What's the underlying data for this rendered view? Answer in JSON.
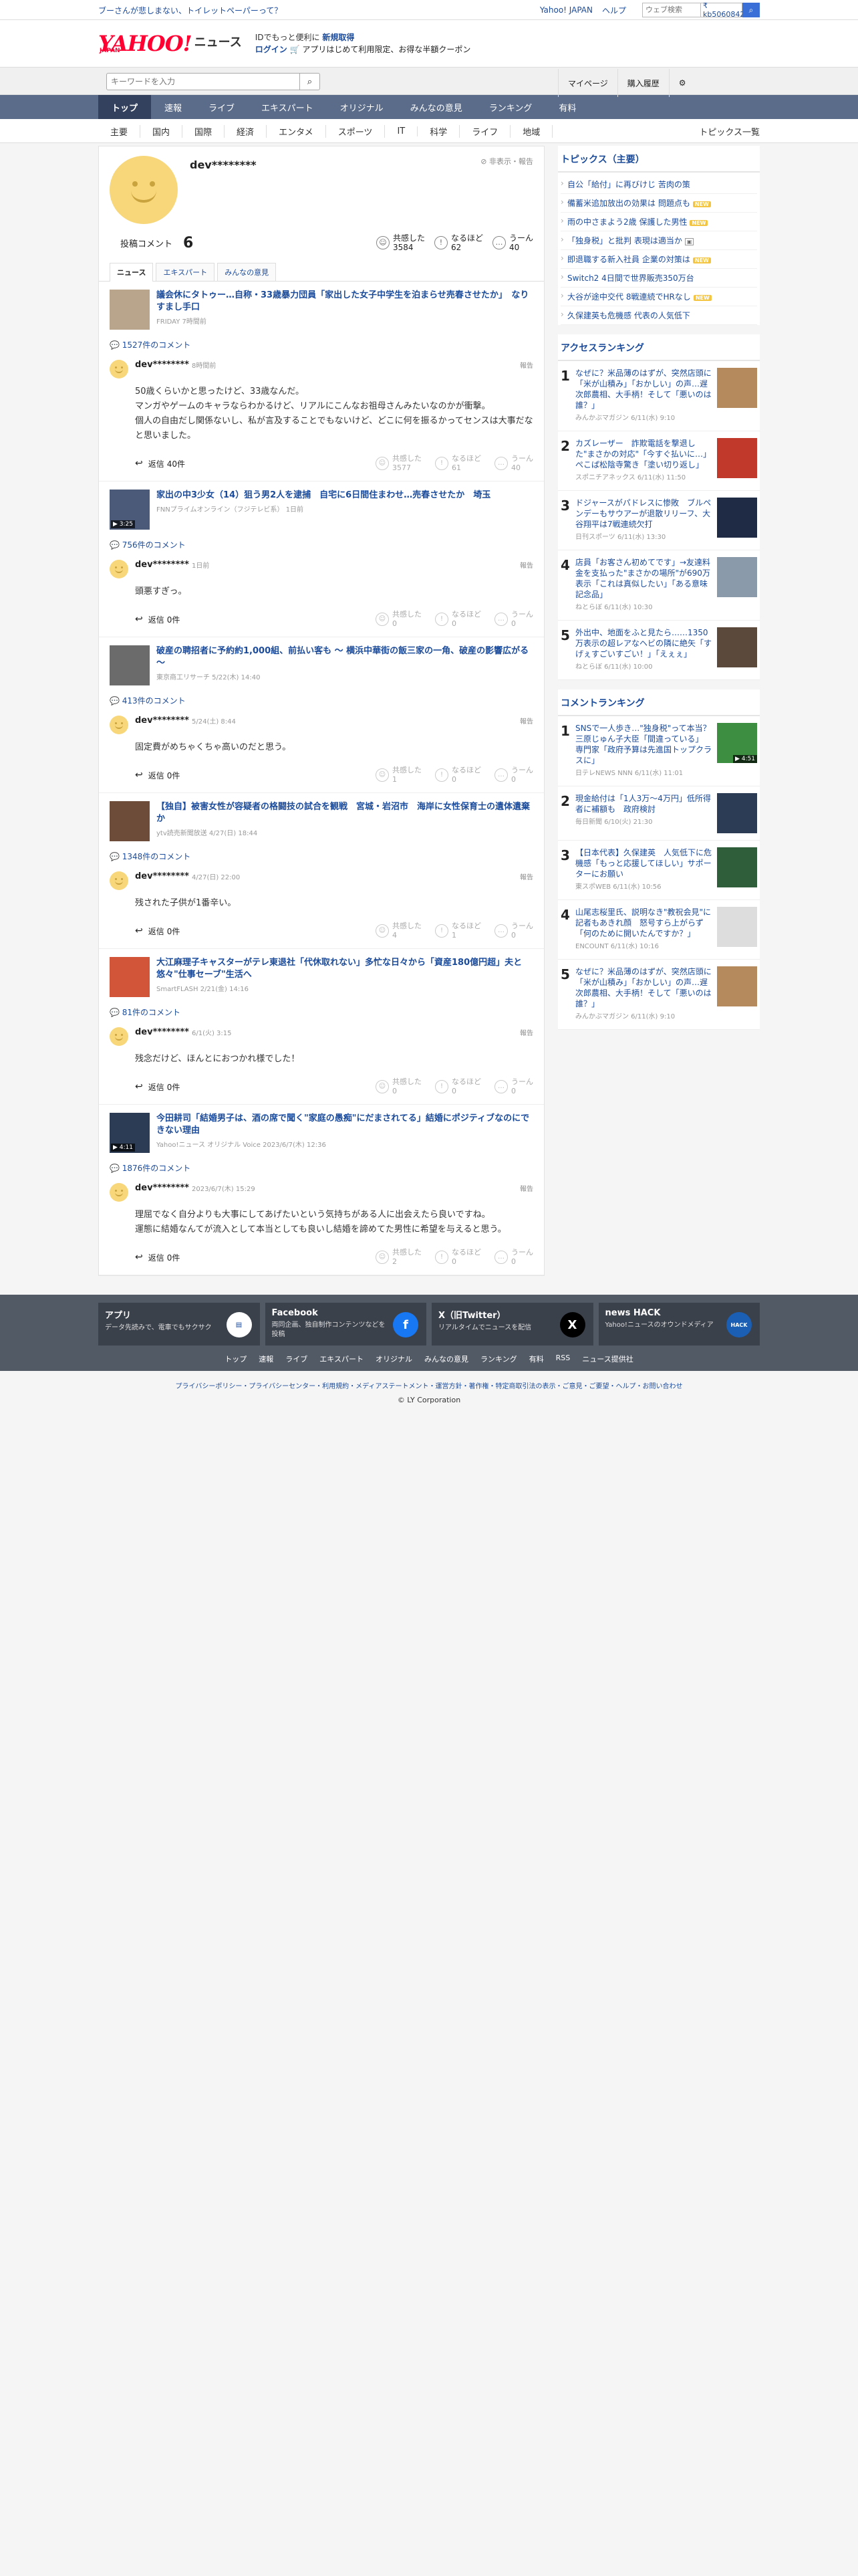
{
  "topbar": {
    "promo": "ブーさんが悲しまない、トイレットペーパーって？",
    "links": [
      "Yahoo! JAPAN",
      "ヘルプ"
    ],
    "search_placeholder": "ウェブ検索",
    "balance": "₹ kb5060842"
  },
  "header": {
    "logo_y": "YAHOO!",
    "logo_japan": "JAPAN",
    "logo_news": "ニュース",
    "line1": "IDでもっと便利に",
    "line1_bold": "新規取得",
    "login": "ログイン",
    "line2": "🛒 アプリはじめて利用限定、お得な半額クーポン"
  },
  "search": {
    "placeholder": "キーワードを入力",
    "right": [
      "マイページ",
      "購入履歴"
    ]
  },
  "nav": [
    "トップ",
    "速報",
    "ライブ",
    "エキスパート",
    "オリジナル",
    "みんなの意見",
    "ランキング",
    "有料"
  ],
  "subnav": [
    "主要",
    "国内",
    "国際",
    "経済",
    "エンタメ",
    "スポーツ",
    "IT",
    "科学",
    "ライフ",
    "地域"
  ],
  "subnav_more": "トピックス一覧",
  "profile": {
    "name": "dev********",
    "hide": "非表示・報告",
    "count_label": "投稿コメント",
    "count": "6",
    "reactions": [
      {
        "label": "共感した",
        "value": "3584",
        "icon": "thumb"
      },
      {
        "label": "なるほど",
        "value": "62",
        "icon": "lightbulb"
      },
      {
        "label": "うーん",
        "value": "40",
        "icon": "hmm"
      }
    ],
    "tabs": [
      "ニュース",
      "エキスパート",
      "みんなの意見"
    ]
  },
  "posts": [
    {
      "title": "議会休にタトゥー…自称・33歳暴力団員「家出した女子中学生を泊まらせ売春させたか」　なりすまし手口",
      "meta": "FRIDAY 7時間前",
      "comment_count": "1527件のコメント",
      "user": "dev********",
      "time": "8時間前",
      "report": "報告",
      "text": "50歳くらいかと思ったけど、33歳なんだ。\nマンガやゲームのキャラならわかるけど、リアルにこんなお祖母さんみたいなのかが衝撃。\n個人の自由だし関係ないし、私が言及することでもないけど、どこに何を振るかってセンスは大事だなと思いました。",
      "reply": "返信",
      "reply_count": "40件",
      "reactions": [
        {
          "label": "共感した",
          "value": "3577"
        },
        {
          "label": "なるほど",
          "value": "61"
        },
        {
          "label": "うーん",
          "value": "40"
        }
      ],
      "thumb_color": "#b9a48c",
      "video": ""
    },
    {
      "title": "家出の中3少女（14）狙う男2人を逮捕　自宅に6日間住まわせ…売春させたか　埼玉",
      "meta": "FNNプライムオンライン（フジテレビ系） 1日前",
      "comment_count": "756件のコメント",
      "user": "dev********",
      "time": "1日前",
      "report": "報告",
      "text": "頭悪すぎっ。",
      "reply": "返信",
      "reply_count": "0件",
      "reactions": [
        {
          "label": "共感した",
          "value": "0"
        },
        {
          "label": "なるほど",
          "value": "0"
        },
        {
          "label": "うーん",
          "value": "0"
        }
      ],
      "thumb_color": "#4a5a78",
      "video": "▶ 3:25"
    },
    {
      "title": "破産の聘招者に予約約1,000組、前払い客も ～ 横浜中華街の飯三家の一角、破産の影響広がる ～",
      "meta": "東京商工リサーチ 5/22(木) 14:40",
      "comment_count": "413件のコメント",
      "user": "dev********",
      "time": "5/24(土) 8:44",
      "report": "報告",
      "text": "固定費がめちゃくちゃ高いのだと思う。",
      "reply": "返信",
      "reply_count": "0件",
      "reactions": [
        {
          "label": "共感した",
          "value": "1"
        },
        {
          "label": "なるほど",
          "value": "0"
        },
        {
          "label": "うーん",
          "value": "0"
        }
      ],
      "thumb_color": "#6b6b6b",
      "video": ""
    },
    {
      "title": "【独自】被害女性が容疑者の格闘技の試合を観戦　宮城・岩沼市　海岸に女性保育士の遺体遺棄か",
      "meta": "ytv読売新聞放送 4/27(日) 18:44",
      "comment_count": "1348件のコメント",
      "user": "dev********",
      "time": "4/27(日) 22:00",
      "report": "報告",
      "text": "残された子供が1番辛い。",
      "reply": "返信",
      "reply_count": "0件",
      "reactions": [
        {
          "label": "共感した",
          "value": "4"
        },
        {
          "label": "なるほど",
          "value": "1"
        },
        {
          "label": "うーん",
          "value": "0"
        }
      ],
      "thumb_color": "#6e4c3a",
      "video": ""
    },
    {
      "title": "大江麻理子キャスターがテレ東退社「代休取れない」多忙な日々から「資産180億円超」夫と悠々\"仕事セーブ\"生活へ",
      "meta": "SmartFLASH 2/21(金) 14:16",
      "comment_count": "81件のコメント",
      "user": "dev********",
      "time": "6/1(火) 3:15",
      "report": "報告",
      "text": "残念だけど、ほんとにおつかれ様でした！",
      "reply": "返信",
      "reply_count": "0件",
      "reactions": [
        {
          "label": "共感した",
          "value": "0"
        },
        {
          "label": "なるほど",
          "value": "0"
        },
        {
          "label": "うーん",
          "value": "0"
        }
      ],
      "thumb_color": "#d2553a",
      "video": ""
    },
    {
      "title": "今田耕司「結婚男子は、酒の席で聞く\"家庭の愚痴\"にだまされてる」結婚にポジティブなのにできない理由",
      "meta": "Yahoo!ニュース オリジナル Voice 2023/6/7(木) 12:36",
      "comment_count": "1876件のコメント",
      "user": "dev********",
      "time": "2023/6/7(木) 15:29",
      "report": "報告",
      "text": "理屈でなく自分よりも大事にしてあげたいという気持ちがある人に出会えたら良いですね。\n運態に結婚なんてが流入として本当としても良いし結婚を諦めてた男性に希望を与えると思う。",
      "reply": "返信",
      "reply_count": "0件",
      "reactions": [
        {
          "label": "共感した",
          "value": "2"
        },
        {
          "label": "なるほど",
          "value": "0"
        },
        {
          "label": "うーん",
          "value": "0"
        }
      ],
      "thumb_color": "#2d3c55",
      "video": "▶ 4:11"
    }
  ],
  "sidebar": {
    "topics_title": "トピックス（主要）",
    "topics": [
      {
        "text": "自公「給付」に再びけじ 苦肉の策",
        "badge": ""
      },
      {
        "text": "備蓄米追加放出の効果は 問題点も",
        "badge": "NEW"
      },
      {
        "text": "雨の中さまよう2歳 保護した男性",
        "badge": "NEW"
      },
      {
        "text": "「独身税」と批判 表現は適当か",
        "badge": "cam"
      },
      {
        "text": "即退職する新入社員 企業の対策は",
        "badge": "NEW"
      },
      {
        "text": "Switch2 4日間で世界販売350万台",
        "badge": ""
      },
      {
        "text": "大谷が途中交代 8戦連続でHRなし",
        "badge": "NEW"
      },
      {
        "text": "久保建英も危機感 代表の人気低下",
        "badge": ""
      }
    ],
    "access_title": "アクセスランキング",
    "access": [
      {
        "n": "1",
        "text": "なぜに？米品薄のはずが、突然店頭に「米が山積み」「おかしい」の声…遅次郎農相、大手柄！そして「悪いのは誰？」",
        "src": "みんかぶマガジン 6/11(水) 9:10",
        "color": "#b58a5c",
        "video": ""
      },
      {
        "n": "2",
        "text": "カズレーザー　詐欺電話を撃退した\"まさかの対応\"「今すぐ払いに…」ぺこぱ松陰寺驚き「塗い切り返し」",
        "src": "スポニチアネックス 6/11(水) 11:50",
        "color": "#c0392b",
        "video": ""
      },
      {
        "n": "3",
        "text": "ドジャースがパドレスに惨敗　ブルペンデーもサウアーが退散リリーフ、大谷翔平は7戦連続欠打",
        "src": "日刊スポーツ 6/11(水) 13:30",
        "color": "#1f2a44",
        "video": ""
      },
      {
        "n": "4",
        "text": "店員「お客さん初めてです」→友達料金を支払った\"まさかの場所\"が690万表示「これは真似したい」「ある意味記念品」",
        "src": "ねとらぼ 6/11(水) 10:30",
        "color": "#8a9aaa",
        "video": ""
      },
      {
        "n": "5",
        "text": "外出中、地面をふと見たら……1350万表示の超レアなヘビの隣に絶矢「すげぇすごいすごい！」「えぇぇ」",
        "src": "ねとらぼ 6/11(水) 10:00",
        "color": "#5b4a3c",
        "video": ""
      }
    ],
    "comment_title": "コメントランキング",
    "comments": [
      {
        "n": "1",
        "text": "SNSで一人歩き…\"独身税\"って本当？　三原じゅん子大臣「間違っている」　専門家「政府予算は先進国トップクラスに」",
        "src": "日テレNEWS NNN 6/11(水) 11:01",
        "color": "#3e8e41",
        "video": "▶ 4:51"
      },
      {
        "n": "2",
        "text": "現金給付は「1人3万～4万円」低所得者に補額も　政府検討",
        "src": "毎日新聞 6/10(火) 21:30",
        "color": "#2d3c55",
        "video": ""
      },
      {
        "n": "3",
        "text": "【日本代表】久保建英　人気低下に危機感「もっと応援してほしい」サポーターにお願い",
        "src": "東スポWEB 6/11(水) 10:56",
        "color": "#2e5e3a",
        "video": ""
      },
      {
        "n": "4",
        "text": "山尾志桜里氏、説明なき\"教祝会見\"に記者もあきれ顔　怒号すら上がらず「何のために開いたんですか？」",
        "src": "ENCOUNT 6/11(水) 10:16",
        "color": "#dddddd",
        "video": ""
      },
      {
        "n": "5",
        "text": "なぜに？米品薄のはずが、突然店頭に「米が山積み」「おかしい」の声…遅次郎農相、大手柄！そして「悪いのは誰？」",
        "src": "みんかぶマガジン 6/11(水) 9:10",
        "color": "#b58a5c",
        "video": ""
      }
    ]
  },
  "footer": {
    "cards": [
      {
        "h": "アプリ",
        "d": "データ先読みで、電車でもサクサク",
        "icon": "app",
        "color": "#ffffff"
      },
      {
        "h": "Facebook",
        "d": "両同企画、独自制作コンテンツなどを投稿",
        "icon": "f",
        "color": "#1877f2"
      },
      {
        "h": "X（旧Twitter）",
        "d": "リアルタイムでニュースを配信",
        "icon": "X",
        "color": "#000000"
      },
      {
        "h": "news HACK",
        "d": "Yahoo!ニュースのオウンドメディア",
        "icon": "news HACK",
        "color": "#1a5fb4"
      }
    ],
    "links": [
      "トップ",
      "速報",
      "ライブ",
      "エキスパート",
      "オリジナル",
      "みんなの意見",
      "ランキング",
      "有料",
      "RSS",
      "ニュース提供社"
    ],
    "legal": "プライバシーポリシー・プライバシーセンター・利用規約・メディアステートメント・運営方針・著作権・特定商取引法の表示・ご意見・ご要望・ヘルプ・お問い合わせ",
    "copyright": "© LY Corporation"
  }
}
